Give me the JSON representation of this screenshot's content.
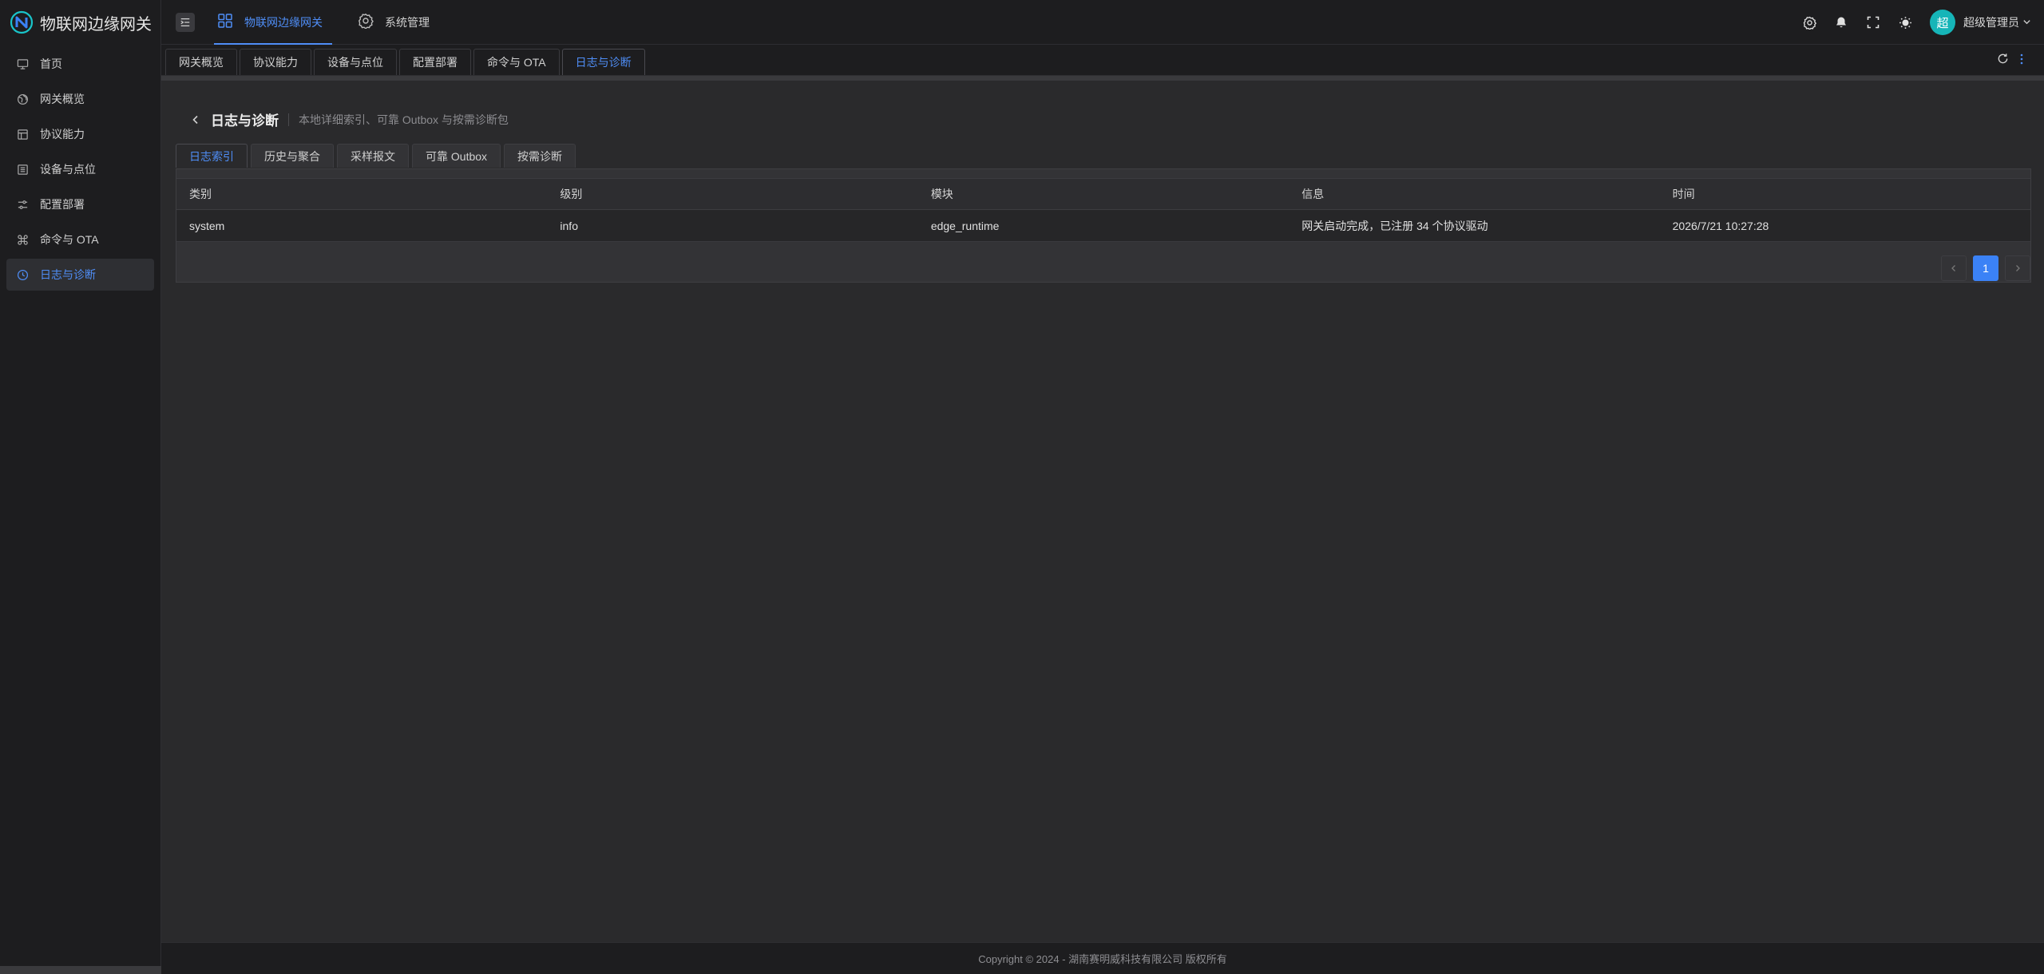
{
  "app": {
    "title": "物联网边缘网关"
  },
  "sidebar": {
    "items": [
      {
        "label": "首页",
        "icon": "monitor-icon"
      },
      {
        "label": "网关概览",
        "icon": "globe-icon"
      },
      {
        "label": "协议能力",
        "icon": "layout-icon"
      },
      {
        "label": "设备与点位",
        "icon": "list-icon"
      },
      {
        "label": "配置部署",
        "icon": "sliders-icon"
      },
      {
        "label": "命令与 OTA",
        "icon": "command-icon"
      },
      {
        "label": "日志与诊断",
        "icon": "clock-icon"
      }
    ],
    "active_index": 6
  },
  "header": {
    "menu": [
      {
        "label": "物联网边缘网关",
        "icon": "grid-icon"
      },
      {
        "label": "系统管理",
        "icon": "gear-icon"
      }
    ],
    "user": {
      "avatar_text": "超",
      "name": "超级管理员"
    }
  },
  "pagetabs": [
    "网关概览",
    "协议能力",
    "设备与点位",
    "配置部署",
    "命令与 OTA",
    "日志与诊断"
  ],
  "page": {
    "title": "日志与诊断",
    "subtitle": "本地详细索引、可靠 Outbox 与按需诊断包",
    "subtabs": [
      "日志索引",
      "历史与聚合",
      "采样报文",
      "可靠 Outbox",
      "按需诊断"
    ]
  },
  "table": {
    "columns": [
      "类别",
      "级别",
      "模块",
      "信息",
      "时间"
    ],
    "rows": [
      [
        "system",
        "info",
        "edge_runtime",
        "网关启动完成，已注册 34 个协议驱动",
        "2026/7/21 10:27:28"
      ]
    ]
  },
  "pagination": {
    "current": "1"
  },
  "footer": {
    "text": "Copyright © 2024 - 湖南赛明威科技有限公司 版权所有"
  },
  "colors": {
    "accent": "#4f8ef7",
    "avatar": "#16b5b8",
    "page_active": "#3b82f6"
  }
}
